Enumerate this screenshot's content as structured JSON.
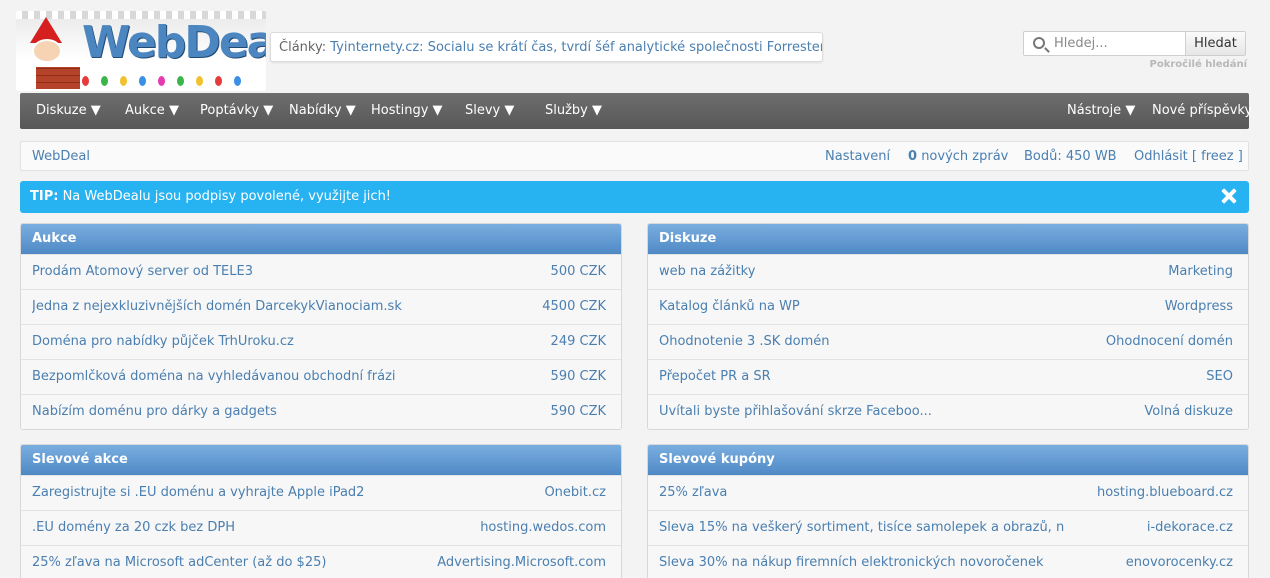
{
  "logo": {
    "text": "WebDeal"
  },
  "news": {
    "label": "Články:",
    "link": "Tyinternety.cz: Socialu se krátí čas, tvrdí šéf analytické společnosti Forrester..."
  },
  "search": {
    "placeholder": "Hledej...",
    "button": "Hledat",
    "advanced": "Pokročilé hledání"
  },
  "nav": {
    "left": [
      "Diskuze ▼",
      "Aukce ▼",
      "Poptávky ▼",
      "Nabídky ▼",
      "Hostingy ▼",
      "Slevy ▼",
      "Služby ▼"
    ],
    "tools": "Nástroje ▼",
    "new_posts": "Nové příspěvky"
  },
  "bar": {
    "crumb": "WebDeal",
    "settings": "Nastavení",
    "messages_count": "0",
    "messages_label": "nových zpráv",
    "points": "Bodů: 450 WB",
    "logout": "Odhlásit [ freez ]"
  },
  "tip": {
    "label": "TIP:",
    "text": "Na WebDealu jsou podpisy povolené, využijte jich!"
  },
  "boxes": {
    "aukce": {
      "title": "Aukce",
      "rows": [
        {
          "title": "Prodám Atomový server od TELE3",
          "value": "500 CZK"
        },
        {
          "title": "Jedna z nejexkluzivnějších domén DarcekykVianociam.sk",
          "value": "4500 CZK"
        },
        {
          "title": "Doména pro nabídky půjček TrhUroku.cz",
          "value": "249 CZK"
        },
        {
          "title": "Bezpomlčková doména na vyhledávanou obchodní frázi",
          "value": "590 CZK"
        },
        {
          "title": "Nabízím doménu pro dárky a gadgets",
          "value": "590 CZK"
        }
      ]
    },
    "diskuze": {
      "title": "Diskuze",
      "rows": [
        {
          "title": "web na zážitky",
          "value": "Marketing"
        },
        {
          "title": "Katalog článků na WP",
          "value": "Wordpress"
        },
        {
          "title": "Ohodnotenie 3 .SK domén",
          "value": "Ohodnocení domén"
        },
        {
          "title": "Přepočet PR a SR",
          "value": "SEO"
        },
        {
          "title": "Uvítali byste přihlašování skrze Faceboo...",
          "value": "Volná diskuze"
        }
      ]
    },
    "slevove_akce": {
      "title": "Slevové akce",
      "rows": [
        {
          "title": "Zaregistrujte si .EU doménu a vyhrajte Apple iPad2",
          "value": "Onebit.cz"
        },
        {
          "title": ".EU domény za 20 czk bez DPH",
          "value": "hosting.wedos.com"
        },
        {
          "title": "25% zľava na Microsoft adCenter (až do $25)",
          "value": "Advertising.Microsoft.com"
        }
      ]
    },
    "slevove_kupony": {
      "title": "Slevové kupóny",
      "rows": [
        {
          "title": "25% zľava",
          "value": "hosting.blueboard.cz"
        },
        {
          "title": "Sleva 15% na veškerý sortiment, tisíce samolepek a obrazů, n",
          "value": "i-dekorace.cz"
        },
        {
          "title": "Sleva 30% na nákup firemních elektronických novoročenek",
          "value": "enovorocenky.cz"
        }
      ]
    }
  }
}
